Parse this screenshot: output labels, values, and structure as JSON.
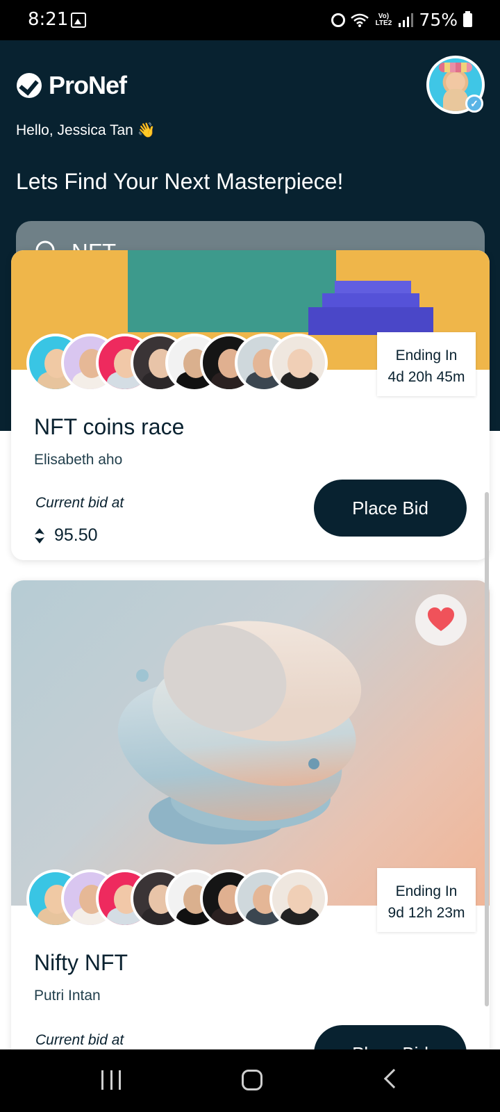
{
  "status_bar": {
    "time": "8:21",
    "network_label": "Vo) LTE2",
    "battery": "75%"
  },
  "header": {
    "app_name": "ProNef",
    "greeting": "Hello, Jessica Tan 👋",
    "headline": "Lets Find Your Next Masterpiece!"
  },
  "search": {
    "value": "NFT"
  },
  "cards": [
    {
      "title": "NFT coins race",
      "author": "Elisabeth aho",
      "ending_label": "Ending In",
      "ending_time": "4d 20h 45m",
      "bid_label": "Current bid at",
      "bid_value": "95.50",
      "button_label": "Place Bid"
    },
    {
      "title": "Nifty NFT",
      "author": "Putri Intan",
      "ending_label": "Ending In",
      "ending_time": "9d 12h 23m",
      "bid_label": "Current bid at",
      "button_label": "Place Bid",
      "favorited": true
    }
  ],
  "colors": {
    "header_bg": "#082230",
    "primary_button": "#082230",
    "heart": "#f0525a",
    "search_bg": "#6f8087"
  },
  "icons": [
    "gallery-icon",
    "alarm-icon",
    "wifi-icon",
    "signal-icon",
    "battery-icon",
    "search-icon",
    "heart-icon",
    "ethereum-icon",
    "verified-icon"
  ]
}
